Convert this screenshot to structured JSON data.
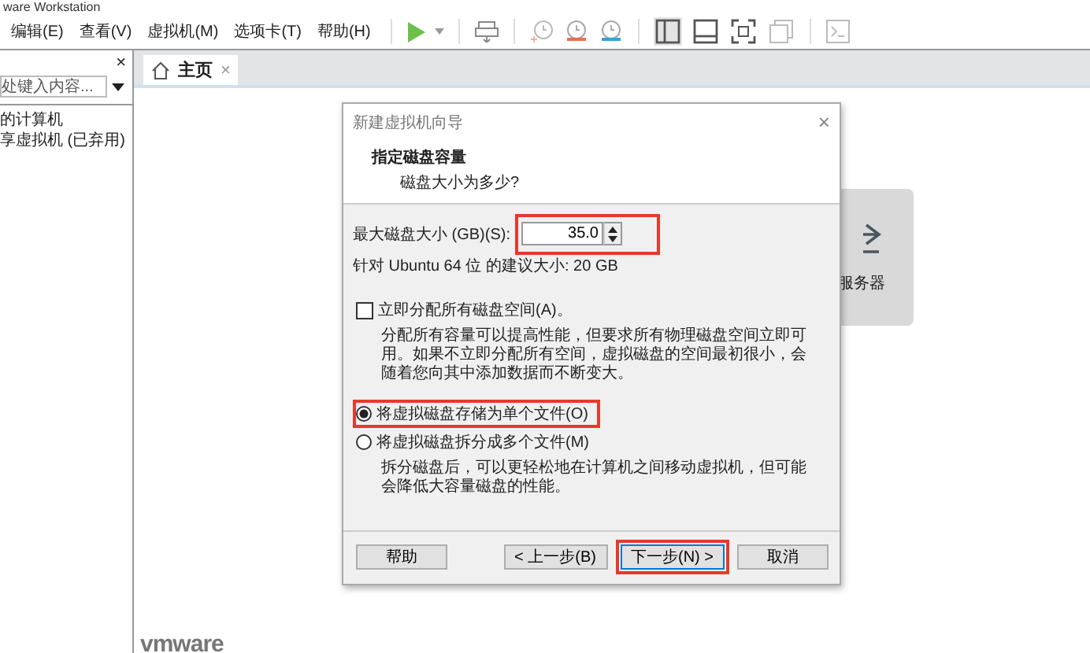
{
  "window": {
    "title": "ware Workstation"
  },
  "menu_bar": [
    "编辑(E)",
    "查看(V)",
    "虚拟机(M)",
    "选项卡(T)",
    "帮助(H)"
  ],
  "library": {
    "close": "×",
    "search_placeholder": "处键入内容...",
    "items": [
      {
        "label": "的计算机"
      },
      {
        "label": "享虚拟机 (已弃用)"
      }
    ]
  },
  "tabs": [
    {
      "label": "主页",
      "selected": true,
      "close": "×"
    }
  ],
  "home": {
    "card_label": "服务器",
    "logo": "vmware"
  },
  "dialog": {
    "title": "新建虚拟机向导",
    "close": "×",
    "heading": "指定磁盘容量",
    "subheading": "磁盘大小为多少?",
    "disk_size": {
      "label": "最大磁盘大小 (GB)(S):",
      "value": "35.0",
      "highlighted": true
    },
    "recommendation": "针对 Ubuntu 64 位 的建议大小: 20 GB",
    "allocate_now": {
      "label": "立即分配所有磁盘空间(A)。",
      "checked": false,
      "description": "分配所有容量可以提高性能，但要求所有物理磁盘空间立即可用。如果不立即分配所有空间，虚拟磁盘的空间最初很小，会随着您向其中添加数据而不断变大。"
    },
    "storage_options": [
      {
        "label": "将虚拟磁盘存储为单个文件(O)",
        "selected": true,
        "highlighted": true
      },
      {
        "label": "将虚拟磁盘拆分成多个文件(M)",
        "selected": false,
        "highlighted": false,
        "description": "拆分磁盘后，可以更轻松地在计算机之间移动虚拟机，但可能会降低大容量磁盘的性能。"
      }
    ],
    "buttons": [
      {
        "label": "帮助",
        "kind": "left",
        "default": false,
        "highlighted": false
      },
      {
        "label": "< 上一步(B)",
        "kind": "right",
        "default": false,
        "highlighted": false
      },
      {
        "label": "下一步(N) >",
        "kind": "right",
        "default": true,
        "highlighted": true
      },
      {
        "label": "取消",
        "kind": "right",
        "default": false,
        "highlighted": false
      }
    ]
  }
}
